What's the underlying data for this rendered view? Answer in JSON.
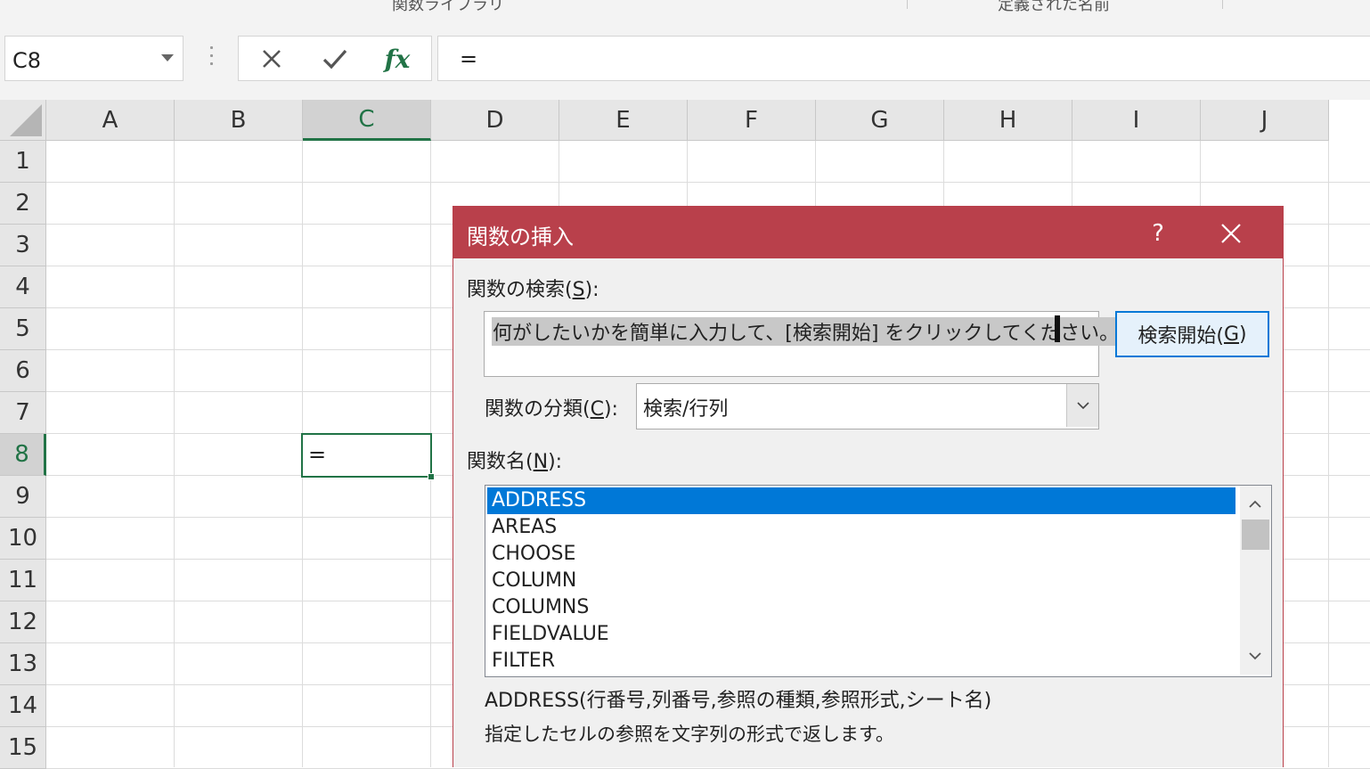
{
  "ribbon": {
    "group_function_library": "関数ライブラリ",
    "group_defined_names": "定義された名前"
  },
  "formula_bar": {
    "name_box": "C8",
    "cancel_icon": "close-icon",
    "enter_icon": "check-icon",
    "fx_label": "fx",
    "formula": "="
  },
  "grid": {
    "columns": [
      "A",
      "B",
      "C",
      "D",
      "E",
      "F",
      "G",
      "H",
      "I",
      "J"
    ],
    "rows": [
      "1",
      "2",
      "3",
      "4",
      "5",
      "6",
      "7",
      "8",
      "9",
      "10",
      "11",
      "12",
      "13",
      "14",
      "15"
    ],
    "selected_column": "C",
    "selected_row": "8",
    "active_cell_value": "="
  },
  "dialog": {
    "title": "関数の挿入",
    "help_label": "?",
    "search_label_pre": "関数の検索(",
    "search_label_key": "S",
    "search_label_post": "):",
    "search_text": "何がしたいかを簡単に入力して、[検索開始] をクリックしてください。",
    "search_button_pre": "検索開始(",
    "search_button_key": "G",
    "search_button_post": ")",
    "category_label_pre": "関数の分類(",
    "category_label_key": "C",
    "category_label_post": "):",
    "category_value": "検索/行列",
    "function_name_label_pre": "関数名(",
    "function_name_label_key": "N",
    "function_name_label_post": "):",
    "functions": [
      "ADDRESS",
      "AREAS",
      "CHOOSE",
      "COLUMN",
      "COLUMNS",
      "FIELDVALUE",
      "FILTER"
    ],
    "selected_function": "ADDRESS",
    "syntax": "ADDRESS(行番号,列番号,参照の種類,参照形式,シート名)",
    "description": "指定したセルの参照を文字列の形式で返します。"
  },
  "colors": {
    "excel_green": "#217346",
    "dialog_title_bar": "#b9404b",
    "selection_blue": "#0078d7"
  }
}
